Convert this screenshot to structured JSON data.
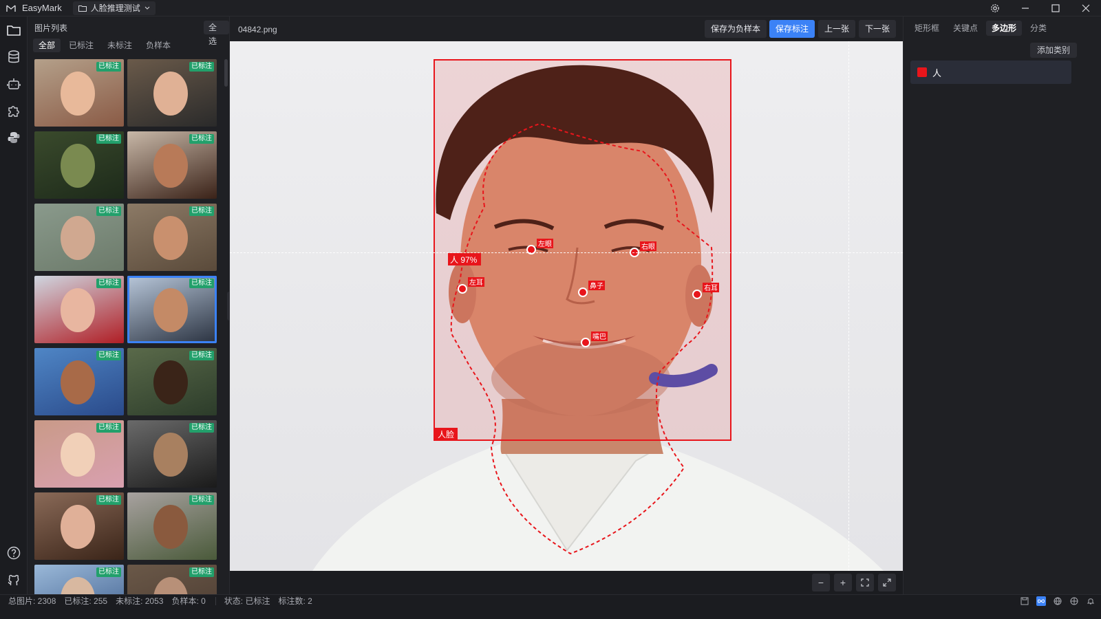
{
  "app": {
    "name": "EasyMark",
    "project": "人脸推理测试"
  },
  "list_panel": {
    "title": "图片列表",
    "select_all": "全选",
    "tabs": [
      "全部",
      "已标注",
      "未标注",
      "负样本"
    ],
    "active_tab": "全部",
    "badge_label": "已标注",
    "thumbs": [
      {
        "tone": "#8a5a45",
        "bg": "#b4a08a",
        "face": "#e8b99a"
      },
      {
        "tone": "#2a2a2a",
        "bg": "#6a5a4a",
        "face": "#e0b195"
      },
      {
        "tone": "#1d2a1a",
        "bg": "#3a4a2c",
        "face": "#7a8a50"
      },
      {
        "tone": "#3a2218",
        "bg": "#c8b8a8",
        "face": "#b87a58"
      },
      {
        "tone": "#6c7a6a",
        "bg": "#8a9a8c",
        "face": "#d0a890"
      },
      {
        "tone": "#5a4a3a",
        "bg": "#8c7a66",
        "face": "#c9906e"
      },
      {
        "tone": "#b01e25",
        "bg": "#cfd6e0",
        "face": "#e8b6a0"
      },
      {
        "tone": "#2a3240",
        "bg": "#b8c7da",
        "face": "#c48a66"
      },
      {
        "tone": "#2a4a8a",
        "bg": "#4f86c6",
        "face": "#a86a48"
      },
      {
        "tone": "#2c3c2a",
        "bg": "#5a6a4a",
        "face": "#3a2418"
      },
      {
        "tone": "#d9a0b0",
        "bg": "#c99a88",
        "face": "#f1d0b8"
      },
      {
        "tone": "#1a1a1a",
        "bg": "#6a6a6a",
        "face": "#a88060"
      },
      {
        "tone": "#3a2418",
        "bg": "#8a6a58",
        "face": "#e0b098"
      },
      {
        "tone": "#4a5a3a",
        "bg": "#a8a2a0",
        "face": "#8a5a3e"
      },
      {
        "tone": "#3a5a8a",
        "bg": "#9ab8d8",
        "face": "#d8b8a0"
      },
      {
        "tone": "#4a3a30",
        "bg": "#6a5848",
        "face": "#b89078"
      }
    ]
  },
  "toolbar": {
    "filename": "04842.png",
    "save_negative": "保存为负样本",
    "save_annotation": "保存标注",
    "prev": "上一张",
    "next": "下一张"
  },
  "annotation": {
    "box_label": "人脸",
    "confidence_label": "人 97%",
    "keypoints": [
      {
        "name": "左眼"
      },
      {
        "name": "右眼"
      },
      {
        "name": "鼻子"
      },
      {
        "name": "左耳"
      },
      {
        "name": "右耳"
      },
      {
        "name": "嘴巴"
      }
    ]
  },
  "right_panel": {
    "tabs": [
      "矩形框",
      "关键点",
      "多边形",
      "分类"
    ],
    "active_tab": "多边形",
    "add_class": "添加类别",
    "classes": [
      {
        "name": "人",
        "color": "#e8151b"
      }
    ]
  },
  "status": {
    "total": "总图片: 2308",
    "annotated": "已标注: 255",
    "unannotated": "未标注: 2053",
    "negative": "负样本: 0",
    "state": "状态: 已标注",
    "count": "标注数: 2"
  },
  "colors": {
    "accent": "#3b82f6",
    "annotation_red": "#e8151b",
    "badge_green": "#22a06b"
  }
}
